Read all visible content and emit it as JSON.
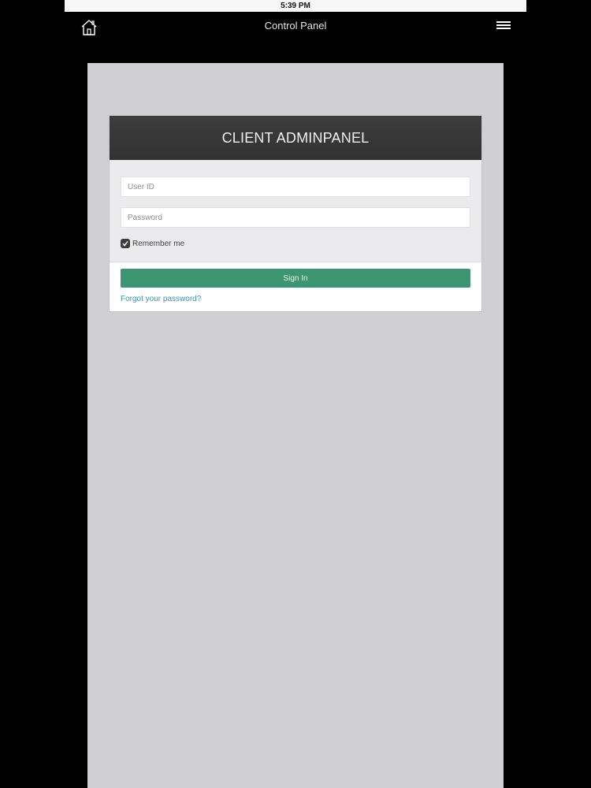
{
  "status_bar": {
    "time": "5:39 PM"
  },
  "nav": {
    "title": "Control Panel",
    "left_icon": "home-icon",
    "right_icon": "hamburger-menu-icon"
  },
  "login_panel": {
    "header": "CLIENT ADMINPANEL",
    "user_id": {
      "placeholder": "User ID",
      "value": ""
    },
    "password": {
      "placeholder": "Password",
      "value": ""
    },
    "remember_me": {
      "label": "Remember me",
      "checked": true
    },
    "sign_in_label": "Sign In",
    "forgot_password_label": "Forgot your password?"
  },
  "colors": {
    "background": "#000000",
    "content_bg": "#d0cfd1",
    "header_bg": "#363636",
    "form_bg": "#ebeaec",
    "primary_button": "#3d9671",
    "link": "#3f8fb5"
  }
}
